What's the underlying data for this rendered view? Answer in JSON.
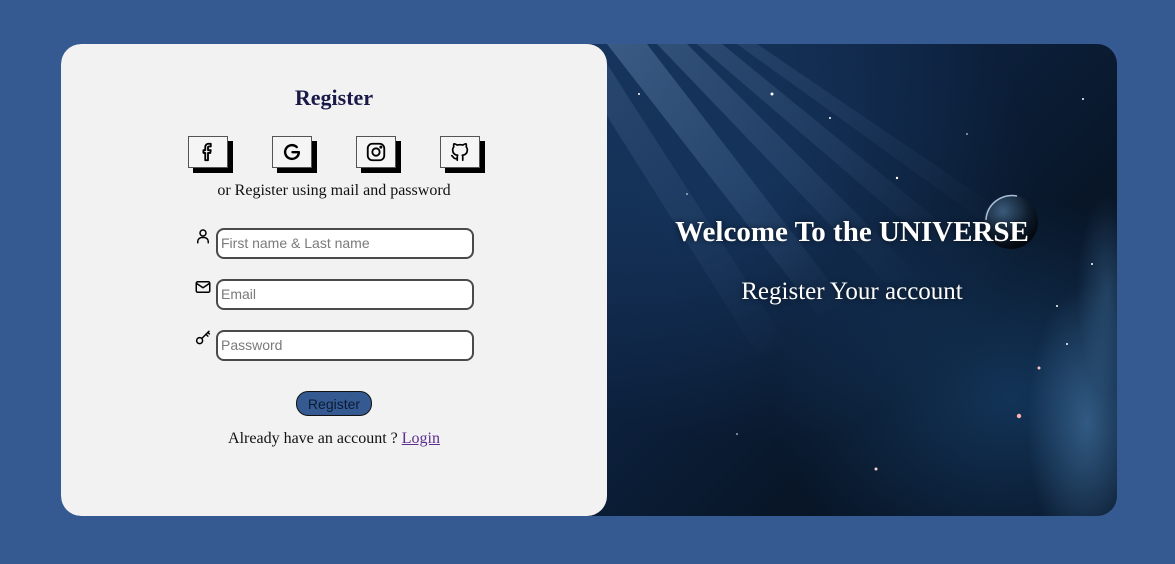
{
  "form": {
    "title": "Register",
    "social_buttons": [
      {
        "icon": "facebook-icon"
      },
      {
        "icon": "google-icon"
      },
      {
        "icon": "instagram-icon"
      },
      {
        "icon": "github-icon"
      }
    ],
    "subtitle": "or Register using mail and password",
    "fields": {
      "name": {
        "icon": "user-icon",
        "placeholder": "First name & Last name",
        "value": ""
      },
      "email": {
        "icon": "mail-icon",
        "placeholder": "Email",
        "value": ""
      },
      "password": {
        "icon": "key-icon",
        "placeholder": "Password",
        "value": ""
      }
    },
    "submit_label": "Register",
    "login_prompt": "Already have an account ?",
    "login_link": "Login"
  },
  "hero": {
    "heading": "Welcome To the UNIVERSE",
    "subheading": "Register Your account"
  },
  "colors": {
    "page_background": "#345a91",
    "panel_background": "#f2f2f2",
    "title_color": "#1a1a4a",
    "button_background": "#345a91",
    "link_color": "#5b2e8e"
  }
}
